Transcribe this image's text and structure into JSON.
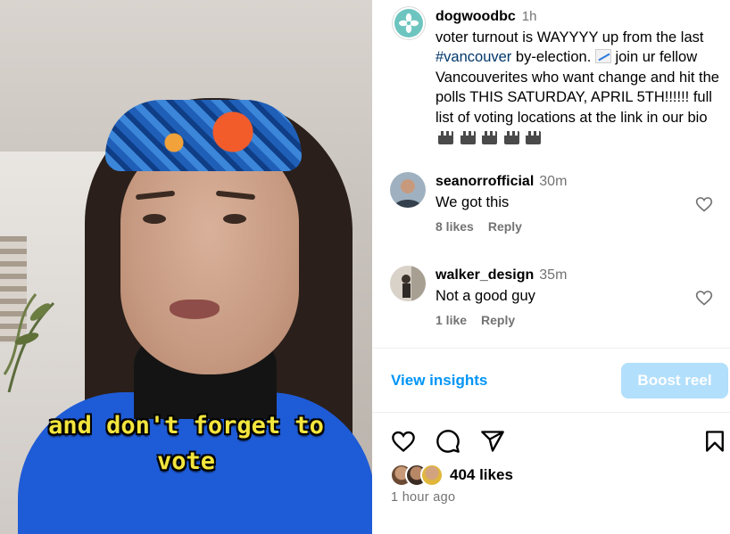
{
  "video": {
    "caption_lines": [
      "and don't forget to",
      "vote"
    ]
  },
  "post": {
    "username": "dogwoodbc",
    "time": "1h",
    "caption_part1": "voter turnout is WAYYYY up from the last ",
    "hashtag": "#vancouver",
    "caption_part2": " by-election. ",
    "caption_part3": " join ur fellow Vancouverites who want change and hit the polls THIS SATURDAY, APRIL 5TH!!!!!! full list of voting locations at the link in our bio "
  },
  "comments": [
    {
      "username": "seanorrofficial",
      "time": "30m",
      "text": "We got this",
      "likes": "8 likes",
      "reply": "Reply"
    },
    {
      "username": "walker_design",
      "time": "35m",
      "text": "Not a good guy",
      "likes": "1 like",
      "reply": "Reply"
    }
  ],
  "actions": {
    "insights_label": "View insights",
    "boost_label": "Boost reel",
    "likes": "404 likes",
    "posted": "1 hour ago"
  },
  "colors": {
    "link_blue": "#0095f6",
    "boost_disabled": "#b2dffc",
    "hashtag": "#00376b",
    "muted": "#737373"
  }
}
